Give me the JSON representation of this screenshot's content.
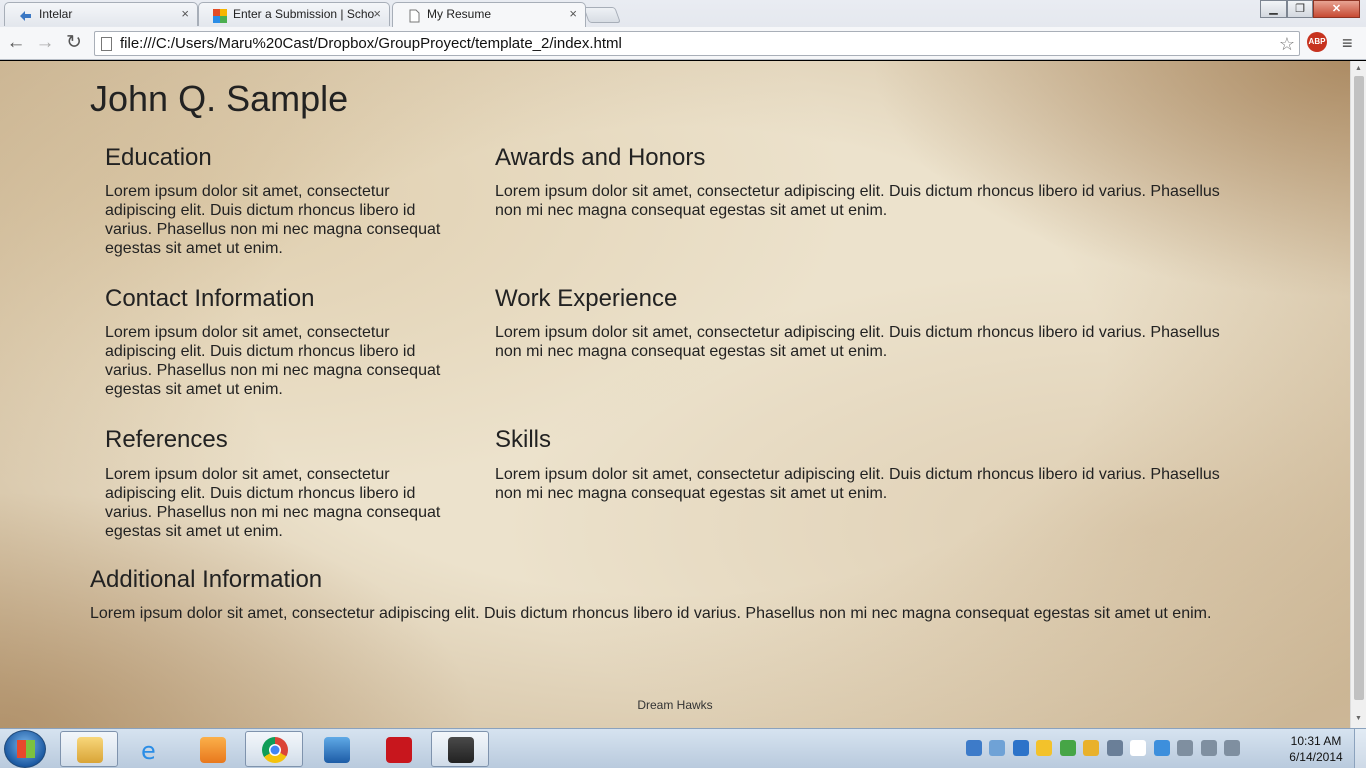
{
  "browser": {
    "tabs": [
      {
        "title": "Intelar",
        "icon": "intelar-icon"
      },
      {
        "title": "Enter a Submission | Scho",
        "icon": "puzzle-icon"
      },
      {
        "title": "My Resume",
        "icon": "page-icon"
      }
    ],
    "tab_close": "×",
    "url": "file:///C:/Users/Maru%20Cast/Dropbox/GroupProyect/template_2/index.html",
    "abp_label": "ABP",
    "window": {
      "minimize": "▁",
      "maximize": "❐",
      "close": "✕"
    }
  },
  "resume": {
    "name": "John Q. Sample",
    "sections": {
      "education": {
        "title": "Education",
        "text": "Lorem ipsum dolor sit amet, consectetur adipiscing elit. Duis dictum rhoncus libero id varius. Phasellus non mi nec magna consequat egestas sit amet ut enim."
      },
      "awards": {
        "title": "Awards and Honors",
        "text": "Lorem ipsum dolor sit amet, consectetur adipiscing elit. Duis dictum rhoncus libero id varius. Phasellus non mi nec magna consequat egestas sit amet ut enim."
      },
      "contact": {
        "title": "Contact Information",
        "text": "Lorem ipsum dolor sit amet, consectetur adipiscing elit. Duis dictum rhoncus libero id varius. Phasellus non mi nec magna consequat egestas sit amet ut enim."
      },
      "work": {
        "title": "Work Experience",
        "text": "Lorem ipsum dolor sit amet, consectetur adipiscing elit. Duis dictum rhoncus libero id varius. Phasellus non mi nec magna consequat egestas sit amet ut enim."
      },
      "references": {
        "title": "References",
        "text": "Lorem ipsum dolor sit amet, consectetur adipiscing elit. Duis dictum rhoncus libero id varius. Phasellus non mi nec magna consequat egestas sit amet ut enim."
      },
      "skills": {
        "title": "Skills",
        "text": "Lorem ipsum dolor sit amet, consectetur adipiscing elit. Duis dictum rhoncus libero id varius. Phasellus non mi nec magna consequat egestas sit amet ut enim."
      },
      "additional": {
        "title": "Additional Information",
        "text": "Lorem ipsum dolor sit amet, consectetur adipiscing elit. Duis dictum rhoncus libero id varius. Phasellus non mi nec magna consequat egestas sit amet ut enim."
      }
    },
    "footer": "Dream Hawks"
  },
  "taskbar": {
    "apps": [
      {
        "name": "file-explorer-icon",
        "open": true
      },
      {
        "name": "internet-explorer-icon",
        "open": false
      },
      {
        "name": "media-player-icon",
        "open": false
      },
      {
        "name": "chrome-icon",
        "open": true
      },
      {
        "name": "app-a-icon",
        "open": false
      },
      {
        "name": "app-l-icon",
        "open": false
      },
      {
        "name": "sublime-text-icon",
        "open": true
      }
    ],
    "clock": {
      "time": "10:31 AM",
      "date": "6/14/2014"
    }
  },
  "colors": {
    "paper": "#ece2cc",
    "text": "#222222",
    "chrome_bg": "#f6f7f9",
    "taskbar": "#c5d5e6"
  }
}
